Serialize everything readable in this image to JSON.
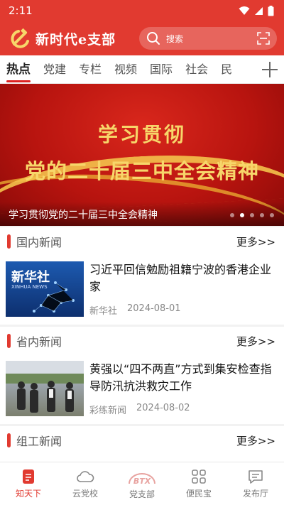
{
  "status": {
    "time": "2:11"
  },
  "header": {
    "brand": "新时代e支部",
    "search_placeholder": "搜索"
  },
  "tabs": [
    {
      "label": "热点"
    },
    {
      "label": "党建"
    },
    {
      "label": "专栏"
    },
    {
      "label": "视频"
    },
    {
      "label": "国际"
    },
    {
      "label": "社会"
    },
    {
      "label": "民"
    }
  ],
  "banner": {
    "line1": "学习贯彻",
    "line2": "党的二十届三中全会精神",
    "caption": "学习贯彻党的二十届三中全会精神"
  },
  "sections": [
    {
      "title": "国内新闻",
      "more": "更多>>",
      "item": {
        "title": "习近平回信勉励祖籍宁波的香港企业家",
        "source": "新华社",
        "date": "2024-08-01",
        "thumb_text": "新华社",
        "thumb_sub": "XINHUA NEWS"
      }
    },
    {
      "title": "省内新闻",
      "more": "更多>>",
      "item": {
        "title": "黄强以“四不两直”方式到集安检查指导防汛抗洪救灾工作",
        "source": "彩练新闻",
        "date": "2024-08-02"
      }
    },
    {
      "title": "组工新闻",
      "more": "更多>>"
    }
  ],
  "bottom_nav": [
    {
      "label": "知天下",
      "icon": "document-icon"
    },
    {
      "label": "云党校",
      "icon": "cloud-icon"
    },
    {
      "label": "党支部",
      "icon": "btx-logo-icon",
      "badge": "BTX"
    },
    {
      "label": "便民宝",
      "icon": "grid-icon"
    },
    {
      "label": "发布厅",
      "icon": "message-icon"
    }
  ],
  "colors": {
    "accent": "#e13a30",
    "banner_gold": "#f7d66a"
  }
}
